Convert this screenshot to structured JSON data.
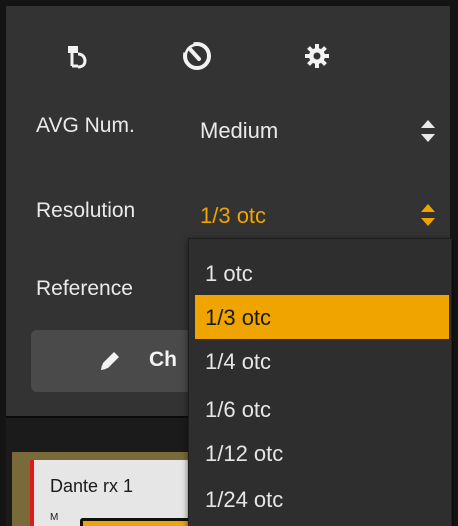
{
  "colors": {
    "panel_background": "#333333",
    "accent": "#f0a400",
    "text": "#eaeaea",
    "dropdown_background": "#2e2e2e"
  },
  "toolbar": {
    "icons": [
      "microphone-icon",
      "gauge-icon",
      "gear-icon"
    ]
  },
  "settings": {
    "avg": {
      "label": "AVG Num.",
      "value": "Medium"
    },
    "resolution": {
      "label": "Resolution",
      "value": "1/3 otc"
    },
    "reference": {
      "label": "Reference"
    }
  },
  "ch_button": {
    "label": "Ch"
  },
  "resolution_dropdown": {
    "selected": "1/3 otc",
    "options": [
      "1 otc",
      "1/3 otc",
      "1/4 otc",
      "1/6 otc",
      "1/12 otc",
      "1/24 otc"
    ]
  },
  "channel": {
    "name": "Dante rx 1",
    "tag": "M"
  }
}
